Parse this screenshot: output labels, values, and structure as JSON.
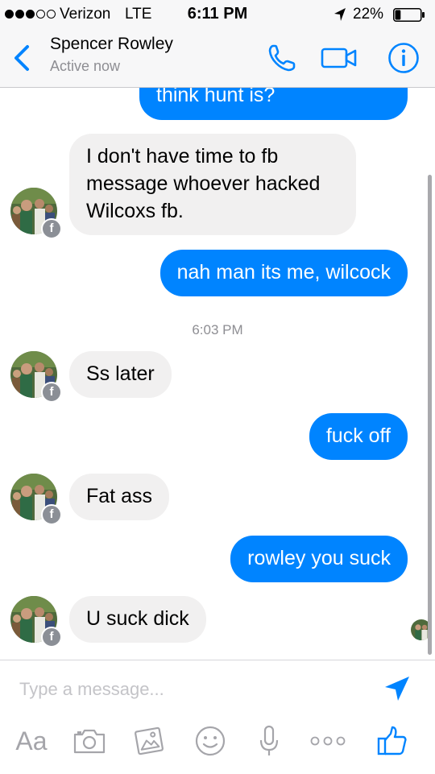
{
  "status_bar": {
    "signal_dots": [
      true,
      true,
      true,
      false,
      false
    ],
    "carrier": "Verizon",
    "network": "LTE",
    "time": "6:11 PM",
    "battery_percent": "22%",
    "battery_level": 0.22
  },
  "header": {
    "contact_name": "Spencer Rowley",
    "status": "Active now"
  },
  "messages": [
    {
      "direction": "outgoing",
      "text": "think hunt is?"
    },
    {
      "direction": "incoming",
      "text": "I don't have time to fb message whoever hacked Wilcoxs fb."
    },
    {
      "direction": "outgoing",
      "text": "nah man its me, wilcock"
    },
    {
      "type": "timestamp",
      "text": "6:03 PM"
    },
    {
      "direction": "incoming",
      "text": "Ss later"
    },
    {
      "direction": "outgoing",
      "text": "fuck off"
    },
    {
      "direction": "incoming",
      "text": "Fat ass"
    },
    {
      "direction": "outgoing",
      "text": "rowley you suck"
    },
    {
      "direction": "incoming",
      "text": "U suck dick"
    }
  ],
  "composer": {
    "placeholder": "Type a message...",
    "font_button_label": "Aa"
  },
  "icons": {
    "back": "chevron-left-icon",
    "call": "phone-icon",
    "video": "video-camera-icon",
    "info": "info-icon",
    "send": "send-arrow-icon",
    "camera": "camera-icon",
    "gallery": "image-icon",
    "sticker": "smiley-icon",
    "voice": "microphone-icon",
    "more": "more-dots-icon",
    "like": "thumbs-up-icon",
    "fb_badge": "facebook-badge-icon"
  },
  "colors": {
    "accent": "#0084ff",
    "incoming_bubble": "#f1f0f0",
    "icon_gray": "#a5a5aa",
    "secondary_text": "#8e8e93"
  }
}
